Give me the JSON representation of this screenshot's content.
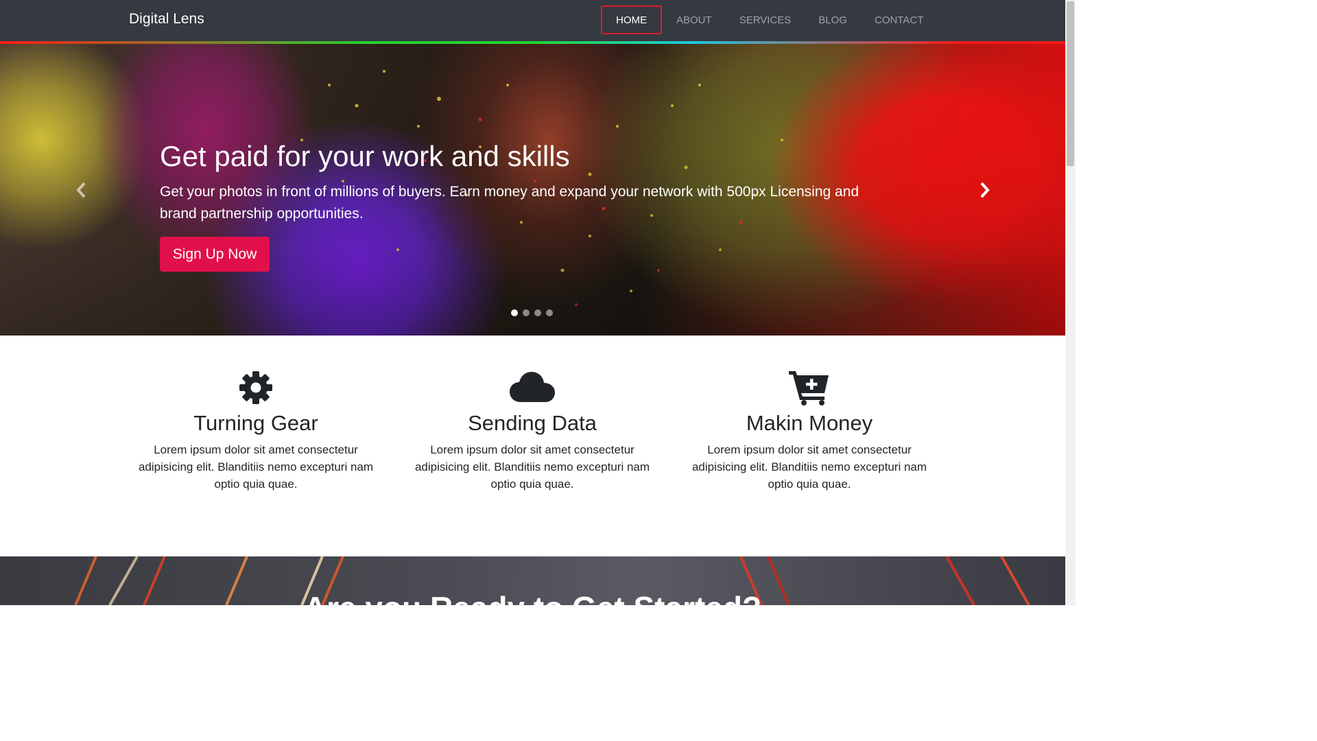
{
  "navbar": {
    "brand": "Digital Lens",
    "links": [
      {
        "label": "HOME",
        "active": true
      },
      {
        "label": "ABOUT"
      },
      {
        "label": "SERVICES"
      },
      {
        "label": "BLOG"
      },
      {
        "label": "CONTACT"
      }
    ],
    "accent_colors": [
      "#ff1a1a",
      "#22d630",
      "#1ec8e0"
    ]
  },
  "hero": {
    "title": "Get paid for your work and skills",
    "text": "Get your photos in front of millions of buyers. Earn money and expand your network with 500px Licensing and brand partnership opportunities.",
    "button_label": "Sign Up Now",
    "button_color": "#e2104a",
    "prev_icon": "chevron-left-icon",
    "next_icon": "chevron-right-icon",
    "slide_count": 4,
    "active_slide": 1
  },
  "features": [
    {
      "icon": "gear-icon",
      "title": "Turning Gear",
      "text": "Lorem ipsum dolor sit amet consectetur adipisicing elit. Blanditiis nemo excepturi nam optio quia quae."
    },
    {
      "icon": "cloud-icon",
      "title": "Sending Data",
      "text": "Lorem ipsum dolor sit amet consectetur adipisicing elit. Blanditiis nemo excepturi nam optio quia quae."
    },
    {
      "icon": "cart-plus-icon",
      "title": "Makin Money",
      "text": "Lorem ipsum dolor sit amet consectetur adipisicing elit. Blanditiis nemo excepturi nam optio quia quae."
    }
  ],
  "cta": {
    "title": "Are you Ready to Get Started?"
  }
}
